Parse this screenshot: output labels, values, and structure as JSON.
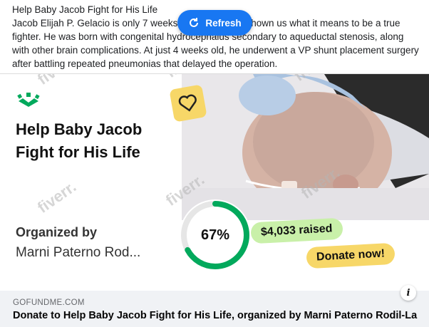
{
  "post": {
    "title": "Help Baby Jacob Fight for His Life",
    "body": "Jacob Elijah P. Gelacio is only 7 weeks old and he has shown us what it means to be a true fighter. He was born with congenital hydrocephalus secondary to aqueductal stenosis, along with other brain complications. At just 4 weeks old, he underwent a VP shunt placement surgery after battling repeated pneumonias that delayed the operation."
  },
  "refresh": {
    "label": "Refresh"
  },
  "card": {
    "title": "Help Baby Jacob Fight for His Life",
    "organized_label": "Organized by",
    "organizer": "Marni Paterno Rod...",
    "progress_label": "67%",
    "progress_fraction": 0.67,
    "raised_label": "$4,033 raised",
    "donate_label": "Donate now!"
  },
  "footer": {
    "domain": "GOFUNDME.COM",
    "link_title": "Donate to Help Baby Jacob Fight for His Life, organized by Marni Paterno Rodil-La"
  },
  "watermark": "fiverr.",
  "colors": {
    "accent": "#1877f2",
    "brand_green": "#02a95c",
    "yellow": "#f7d768",
    "light_green": "#c9f0a9"
  }
}
